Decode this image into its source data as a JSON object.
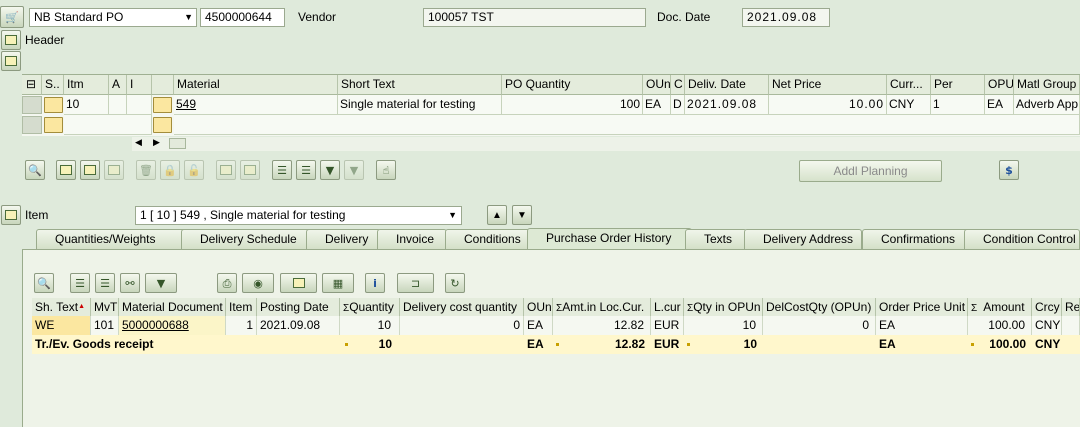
{
  "header_bar": {
    "doc_type": "NB Standard PO",
    "po_number": "4500000644",
    "vendor_label": "Vendor",
    "vendor_value": "100057 TST",
    "doc_date_label": "Doc. Date",
    "doc_date_value": "2021.09.08",
    "header_label": "Header"
  },
  "item_grid": {
    "columns": [
      "S..",
      "Itm",
      "A",
      "I",
      "Material",
      "Short Text",
      "PO Quantity",
      "OUn",
      "C",
      "Deliv. Date",
      "Net Price",
      "Curr...",
      "Per",
      "OPU",
      "Matl Group"
    ],
    "row": {
      "itm": "10",
      "material": "549",
      "short_text": "Single material for testing",
      "po_quantity": "100",
      "oun": "EA",
      "c": "D",
      "deliv_date": "2021.09.08",
      "net_price": "10.00",
      "currency": "CNY",
      "per": "1",
      "opu": "EA",
      "matl_group": "Adverb App"
    }
  },
  "toolbar": {
    "addl_planning": "Addl Planning"
  },
  "item_section": {
    "label": "Item",
    "selector_value": "1 [ 10 ] 549 , Single material for testing"
  },
  "tabs": [
    {
      "label": "Quantities/Weights"
    },
    {
      "label": "Delivery Schedule"
    },
    {
      "label": "Delivery"
    },
    {
      "label": "Invoice"
    },
    {
      "label": "Conditions"
    },
    {
      "label": "Purchase Order History"
    },
    {
      "label": "Texts"
    },
    {
      "label": "Delivery Address"
    },
    {
      "label": "Confirmations"
    },
    {
      "label": "Condition Control"
    }
  ],
  "history": {
    "columns": [
      "Sh. Text",
      "MvT",
      "Material Document",
      "Item",
      "Posting Date",
      "Quantity",
      "Delivery cost quantity",
      "OUn",
      "Amt.in Loc.Cur.",
      "L.cur",
      "Qty in OPUn",
      "DelCostQty (OPUn)",
      "Order Price Unit",
      "Amount",
      "Crcy",
      "Re"
    ],
    "row": {
      "sh_text": "WE",
      "mvt": "101",
      "material_document": "5000000688",
      "item": "1",
      "posting_date": "2021.09.08",
      "quantity": "10",
      "delivery_cost_quantity": "0",
      "oun": "EA",
      "amt_loc": "12.82",
      "lcur": "EUR",
      "qty_opun": "10",
      "delcost_opun": "0",
      "order_price_unit": "EA",
      "amount": "100.00",
      "crcy": "CNY"
    },
    "total": {
      "label": "Tr./Ev. Goods receipt",
      "quantity": "10",
      "oun": "EA",
      "amt_loc": "12.82",
      "lcur": "EUR",
      "qty_opun": "10",
      "order_price_unit": "EA",
      "amount": "100.00",
      "crcy": "CNY"
    }
  },
  "colors": {
    "background": "#dfeadb",
    "selection_yellow": "#fbe7a0",
    "total_row": "#fff7cc",
    "sum_marker": "#c8a000"
  }
}
